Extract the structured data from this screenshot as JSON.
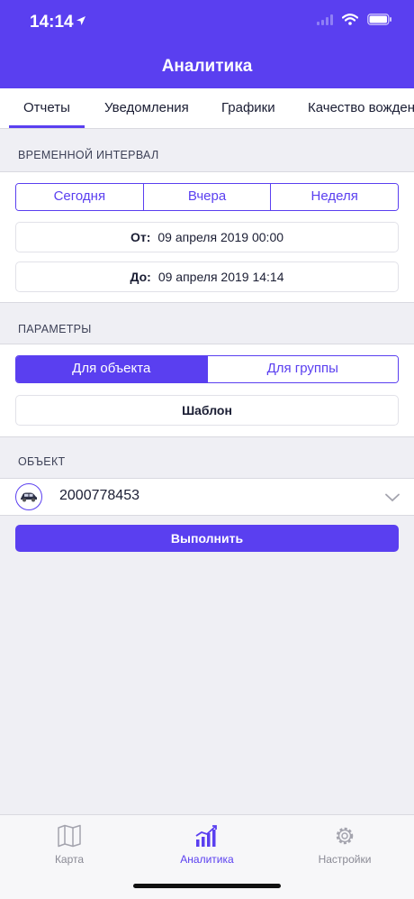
{
  "status_bar": {
    "time": "14:14"
  },
  "nav": {
    "title": "Аналитика"
  },
  "tabs": [
    {
      "label": "Отчеты",
      "active": true
    },
    {
      "label": "Уведомления",
      "active": false
    },
    {
      "label": "Графики",
      "active": false
    },
    {
      "label": "Качество вожден",
      "active": false
    }
  ],
  "time_interval": {
    "header": "ВРЕМЕННОЙ ИНТЕРВАЛ",
    "segments": [
      "Сегодня",
      "Вчера",
      "Неделя"
    ],
    "from_label": "От:",
    "from_value": "09 апреля 2019 00:00",
    "to_label": "До:",
    "to_value": "09 апреля 2019 14:14"
  },
  "parameters": {
    "header": "ПАРАМЕТРЫ",
    "segments": [
      "Для объекта",
      "Для группы"
    ],
    "selected": "Для объекта",
    "template_label": "Шаблон"
  },
  "object": {
    "header": "ОБЪЕКТ",
    "name": "2000778453"
  },
  "run_button": {
    "label": "Выполнить"
  },
  "bottom_tabs": [
    {
      "label": "Карта",
      "icon": "map-icon",
      "active": false
    },
    {
      "label": "Аналитика",
      "icon": "analytics-icon",
      "active": true
    },
    {
      "label": "Настройки",
      "icon": "gear-icon",
      "active": false
    }
  ],
  "colors": {
    "accent": "#5a3ff0",
    "background": "#efeff4",
    "text": "#1a1d33"
  }
}
